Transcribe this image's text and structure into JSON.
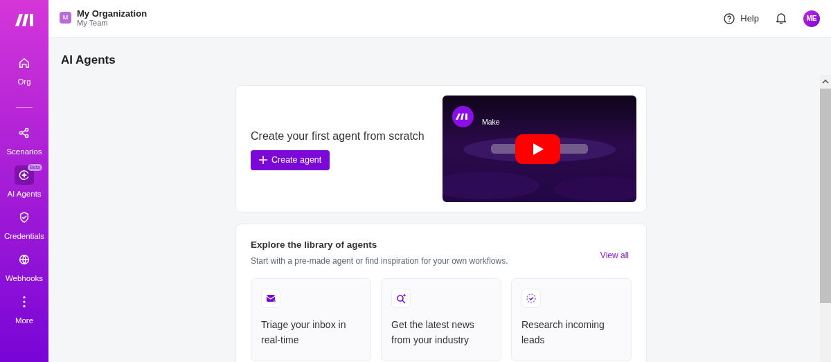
{
  "sidebar": {
    "items": [
      {
        "label": "Org",
        "selected": false
      },
      {
        "label": "Scenarios",
        "selected": false
      },
      {
        "label": "AI Agents",
        "selected": true,
        "badge": "Beta"
      },
      {
        "label": "Credentials",
        "selected": false
      },
      {
        "label": "Webhooks",
        "selected": false
      },
      {
        "label": "More",
        "selected": false
      }
    ]
  },
  "header": {
    "org_initial": "M",
    "org_name": "My Organization",
    "team": "My Team",
    "help": "Help",
    "avatar": "ME"
  },
  "page_title": "AI Agents",
  "create_card": {
    "heading": "Create your first agent from scratch",
    "button": "Create agent",
    "video": {
      "channel": "Make"
    }
  },
  "library": {
    "heading": "Explore the library of agents",
    "subtitle": "Start with a pre-made agent or find inspiration for your own workflows.",
    "view_all": "View all",
    "agents": [
      {
        "title": "Triage your inbox in real-time"
      },
      {
        "title": "Get the latest news from your industry"
      },
      {
        "title": "Research incoming leads"
      }
    ]
  }
}
